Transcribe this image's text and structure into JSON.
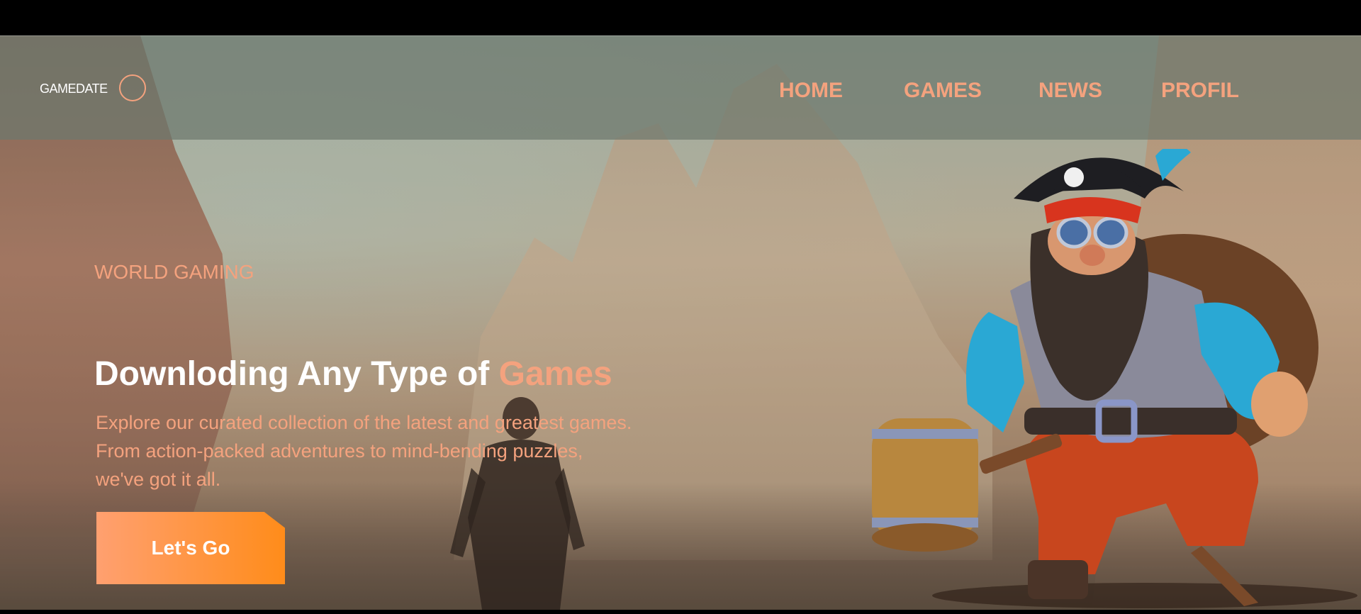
{
  "header": {
    "logo_text": "GAMEDATE",
    "nav": [
      {
        "label": "HOME"
      },
      {
        "label": "GAMES"
      },
      {
        "label": "NEWS"
      },
      {
        "label": "PROFIL"
      }
    ]
  },
  "hero": {
    "tagline": "WORLD GAMING",
    "headline_main": "Downloding Any Type of ",
    "headline_accent": "Games",
    "description": [
      "Explore our curated collection of the latest and greatest games.",
      "From action-packed adventures to mind-bending puzzles,",
      "we've got it all."
    ],
    "cta_label": "Let's Go"
  },
  "colors": {
    "accent": "#f4a27e",
    "button_start": "#ffa070",
    "button_end": "#ff8c1a",
    "nav_bg": "rgba(110,120,110,0.72)"
  },
  "icons": {
    "logo_ring": "circle-outline-icon",
    "hero_character": "pirate-dwarf-illustration",
    "background": "desert-canyon-illustration"
  }
}
